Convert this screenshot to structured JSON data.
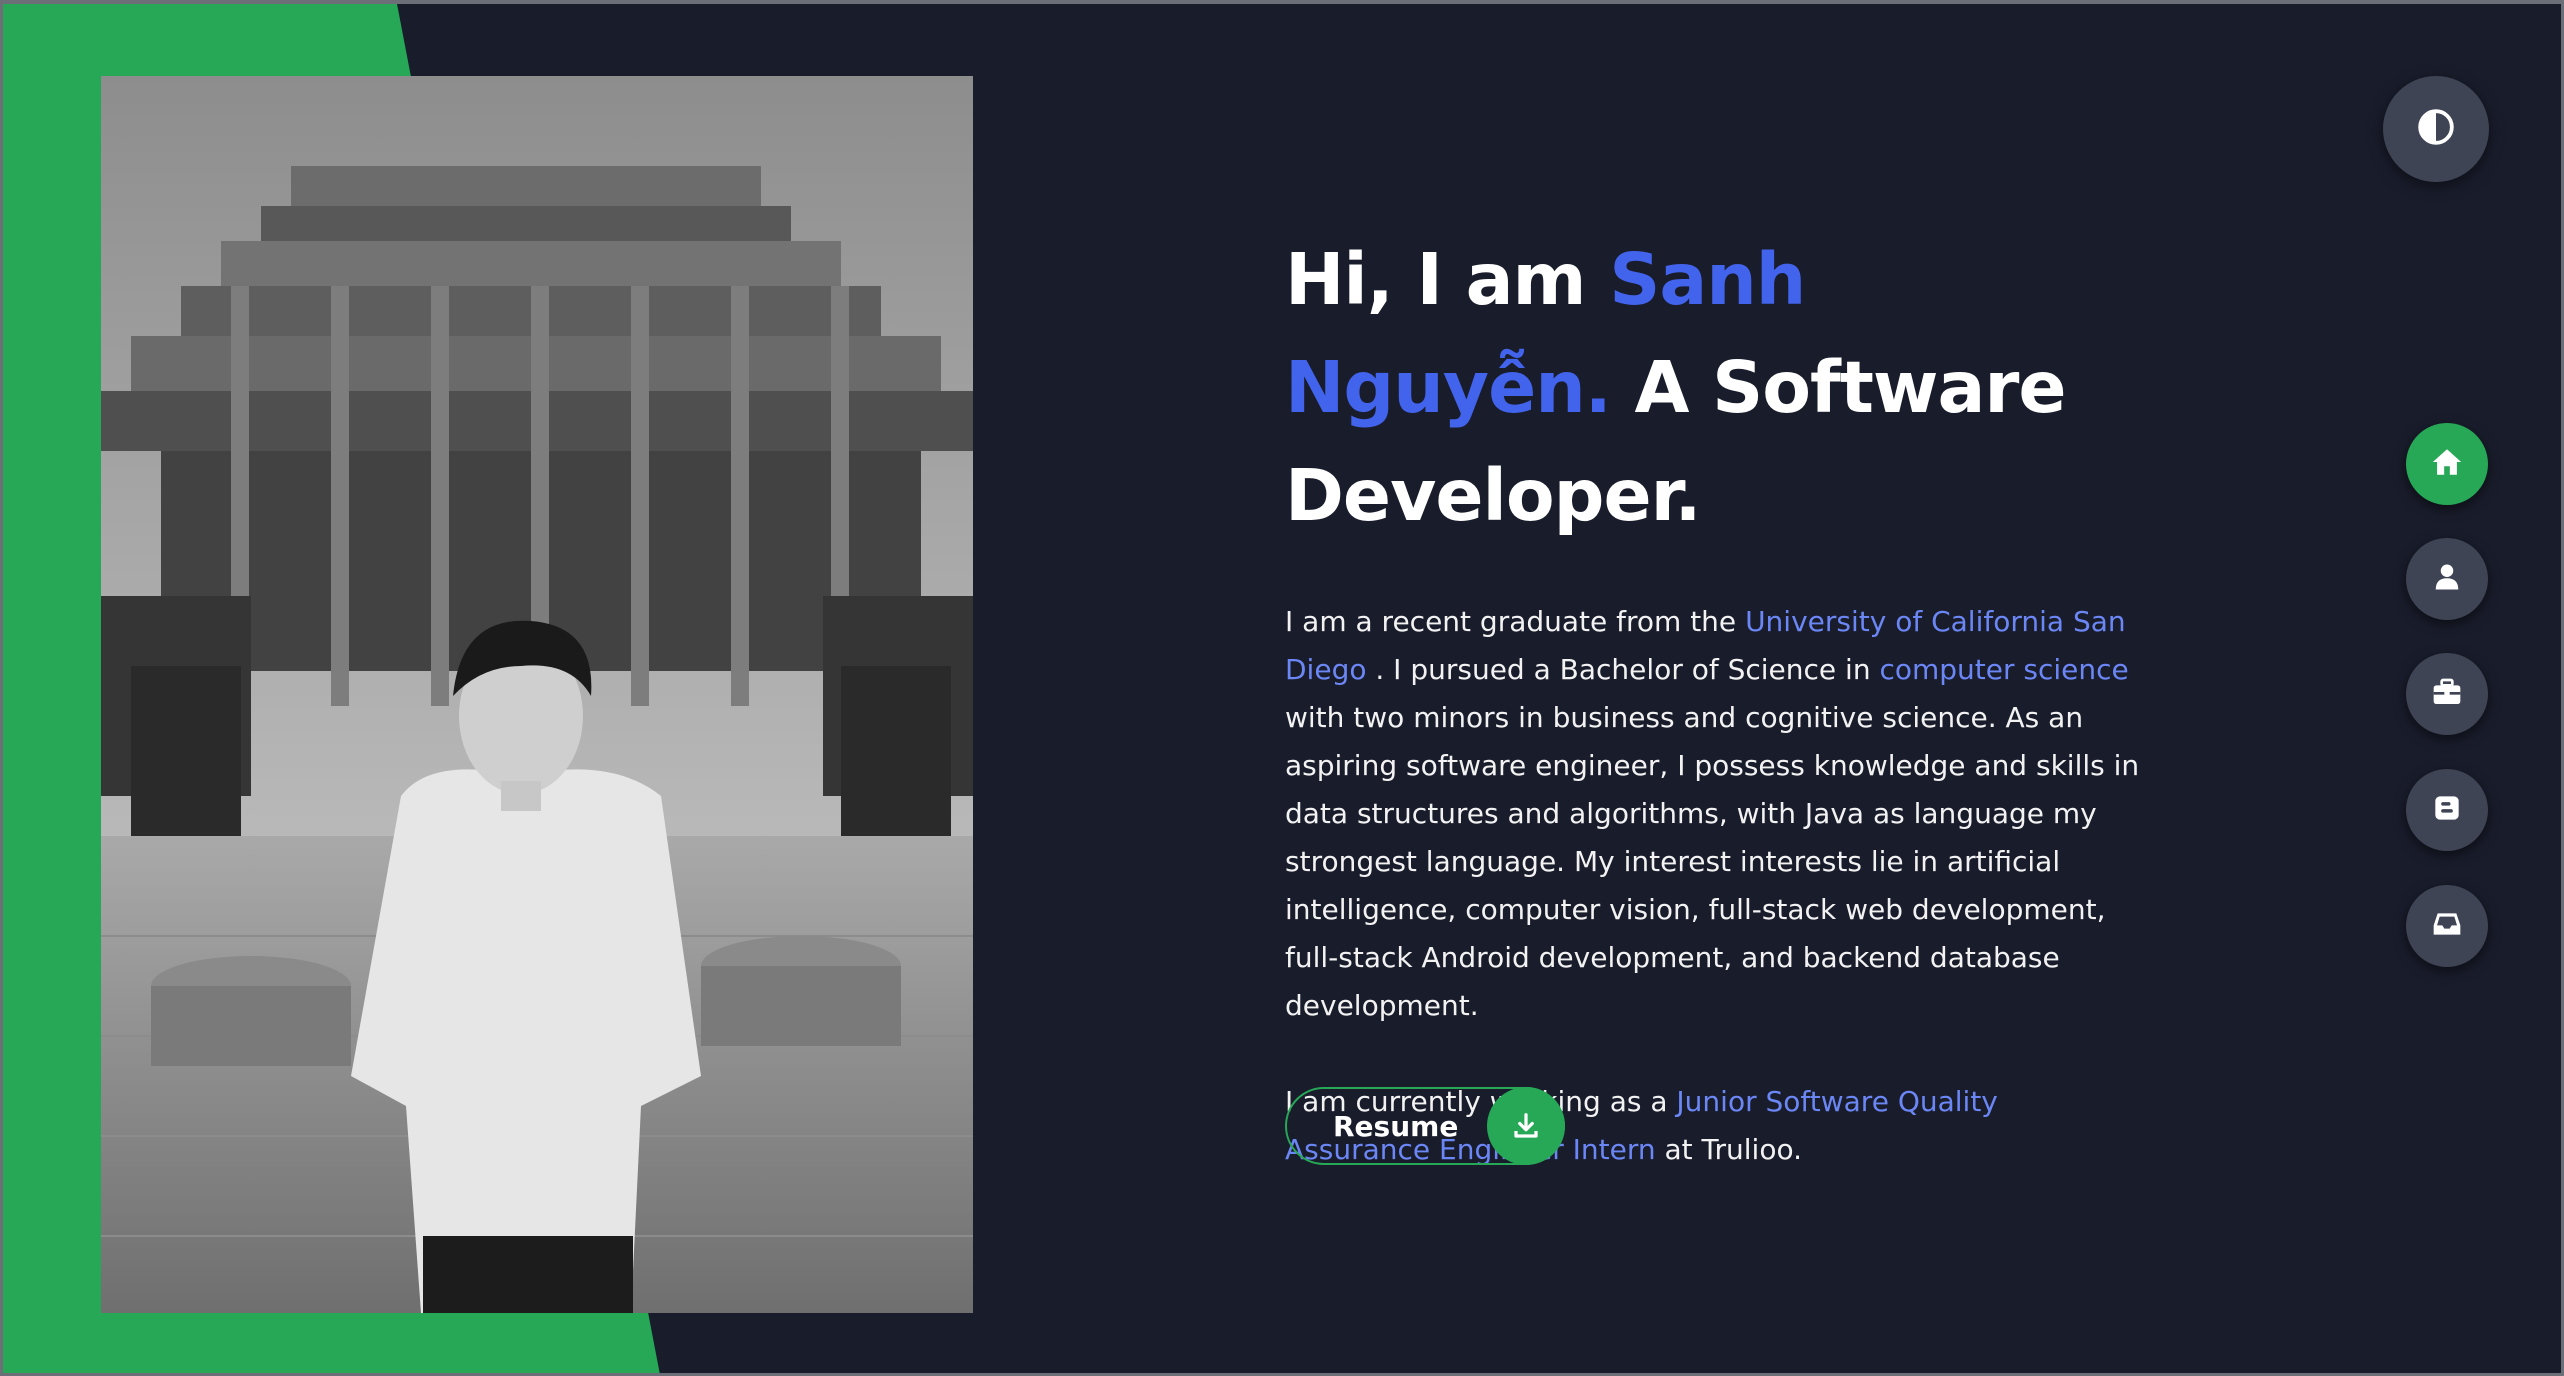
{
  "hero": {
    "heading": {
      "prefix": "Hi, I am ",
      "name": "Sanh Nguyễn.",
      "suffix": " A Software Developer."
    },
    "paragraph1": {
      "t1": "I am a recent graduate from the ",
      "link1": "University of California San Diego",
      "t2": " . I pursued a Bachelor of Science in ",
      "link2": "computer science",
      "t3": " with two minors in business and cognitive science. As an aspiring software engineer, I possess knowledge and skills in data structures and algorithms, with Java as language my strongest language. My interest interests lie in artificial intelligence, computer vision, full-stack web development, full-stack Android development, and backend database development."
    },
    "paragraph2": {
      "t1": "I am currently working as a ",
      "link1": "Junior Software Quality Assurance Engineer Intern",
      "t2": " at Trulioo."
    },
    "resume_button": {
      "label": "Resume",
      "icon": "download-icon"
    }
  },
  "nav": {
    "theme_toggle_icon": "contrast-half-circle-icon",
    "items": [
      {
        "id": "home",
        "icon": "home-icon",
        "active": true
      },
      {
        "id": "about",
        "icon": "user-icon",
        "active": false
      },
      {
        "id": "portfolio",
        "icon": "briefcase-icon",
        "active": false
      },
      {
        "id": "blog",
        "icon": "blog-icon",
        "active": false
      },
      {
        "id": "contact",
        "icon": "inbox-icon",
        "active": false
      }
    ]
  },
  "colors": {
    "background": "#191c2b",
    "accent_green": "#27a857",
    "name_blue": "#4263eb",
    "link_blue": "#6b86f5",
    "nav_gray": "#3e4454"
  }
}
